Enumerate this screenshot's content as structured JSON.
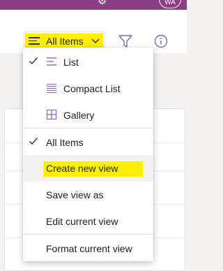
{
  "topbar": {
    "avatar_initials": "WA",
    "settings_icon": "gear-icon"
  },
  "view_switcher": {
    "label": "All Items",
    "icon": "list-lines-icon",
    "chevron": "chevron-down-icon"
  },
  "toolbar": {
    "filter_icon": "filter-icon",
    "info_icon": "info-icon"
  },
  "menu": {
    "layouts": [
      {
        "label": "List",
        "icon": "list-icon",
        "checked": true
      },
      {
        "label": "Compact List",
        "icon": "compact-list-icon",
        "checked": false
      },
      {
        "label": "Gallery",
        "icon": "gallery-icon",
        "checked": false
      }
    ],
    "views": [
      {
        "label": "All Items",
        "checked": true
      }
    ],
    "actions": {
      "create_new_view": "Create new view",
      "save_view_as": "Save view as",
      "edit_current_view": "Edit current view",
      "format_current_view": "Format current view"
    }
  },
  "colors": {
    "accent": "#8a3f83",
    "highlight": "#ffef00",
    "icon_purple": "#8764b8"
  }
}
